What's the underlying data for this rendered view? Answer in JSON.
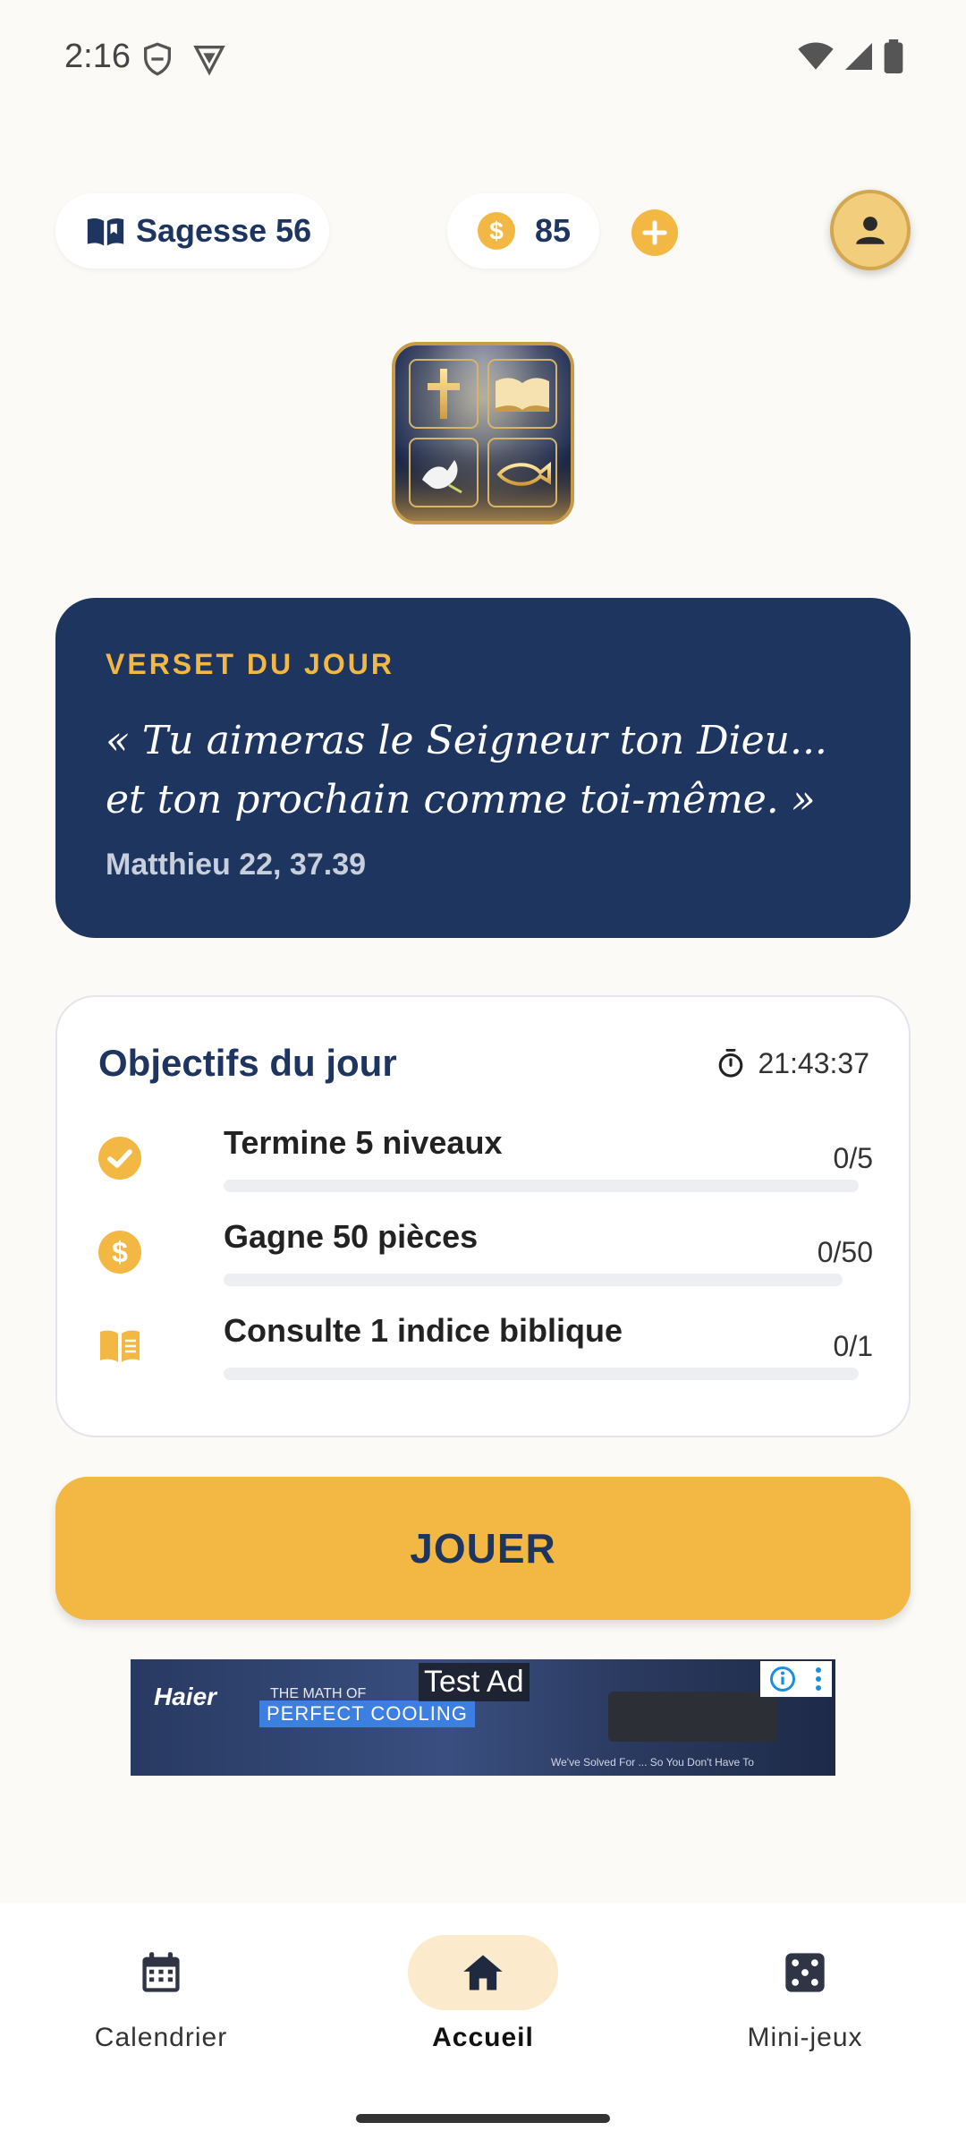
{
  "status_bar": {
    "time": "2:16"
  },
  "header": {
    "wisdom_label": "Sagesse 56",
    "coins": "85"
  },
  "verse": {
    "label": "VERSET DU JOUR",
    "text": "« Tu aimeras le Seigneur ton Dieu... et ton prochain comme toi-même. »",
    "reference": "Matthieu 22, 37.39"
  },
  "objectives": {
    "title": "Objectifs du jour",
    "timer": "21:43:37",
    "items": [
      {
        "label": "Termine 5 niveaux",
        "count": "0/5",
        "progress": 0,
        "icon": "check-circle-icon"
      },
      {
        "label": "Gagne 50 pièces",
        "count": "0/50",
        "progress": 0,
        "icon": "coin-icon"
      },
      {
        "label": "Consulte 1 indice biblique",
        "count": "0/1",
        "progress": 0,
        "icon": "book-icon"
      }
    ]
  },
  "play_button": {
    "label": "JOUER"
  },
  "ad": {
    "label": "Test Ad",
    "brand": "Haier",
    "line1": "THE MATH OF",
    "line2": "PERFECT COOLING",
    "tagline": "We've Solved For ... So You Don't Have To"
  },
  "bottom_nav": [
    {
      "label": "Calendrier",
      "icon": "calendar-icon",
      "active": false
    },
    {
      "label": "Accueil",
      "icon": "home-icon",
      "active": true
    },
    {
      "label": "Mini-jeux",
      "icon": "dice-icon",
      "active": false
    }
  ],
  "colors": {
    "navy": "#1E3560",
    "gold": "#F2B843",
    "background": "#FCFAF6"
  }
}
